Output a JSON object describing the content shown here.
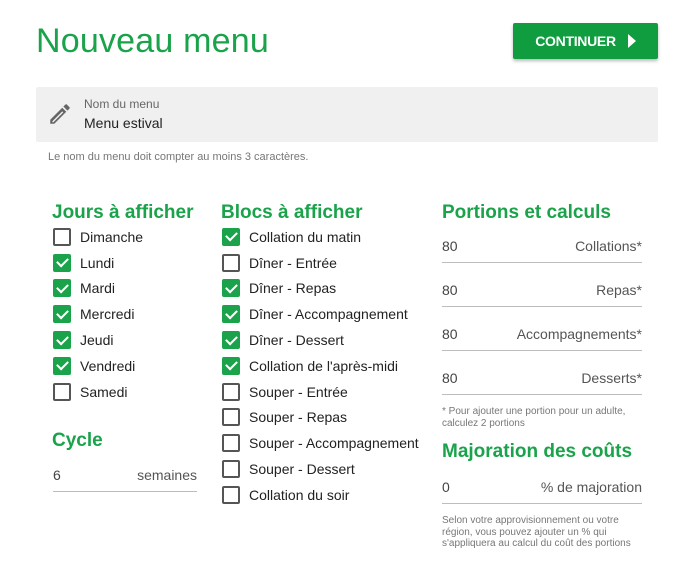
{
  "header": {
    "title": "Nouveau menu",
    "continue_label": "CONTINUER"
  },
  "name_field": {
    "label": "Nom du menu",
    "value": "Menu estival",
    "hint": "Le nom du menu doit compter au moins 3 caractères."
  },
  "days": {
    "heading": "Jours à afficher",
    "items": [
      {
        "label": "Dimanche",
        "checked": false
      },
      {
        "label": "Lundi",
        "checked": true
      },
      {
        "label": "Mardi",
        "checked": true
      },
      {
        "label": "Mercredi",
        "checked": true
      },
      {
        "label": "Jeudi",
        "checked": true
      },
      {
        "label": "Vendredi",
        "checked": true
      },
      {
        "label": "Samedi",
        "checked": false
      }
    ]
  },
  "cycle": {
    "heading": "Cycle",
    "value": "6",
    "unit": "semaines"
  },
  "blocks": {
    "heading": "Blocs à afficher",
    "items": [
      {
        "label": "Collation du matin",
        "checked": true
      },
      {
        "label": "Dîner - Entrée",
        "checked": false
      },
      {
        "label": "Dîner - Repas",
        "checked": true
      },
      {
        "label": "Dîner - Accompagnement",
        "checked": true
      },
      {
        "label": "Dîner - Dessert",
        "checked": true
      },
      {
        "label": "Collation de l'après-midi",
        "checked": true
      },
      {
        "label": "Souper - Entrée",
        "checked": false
      },
      {
        "label": "Souper - Repas",
        "checked": false
      },
      {
        "label": "Souper - Accompagnement",
        "checked": false
      },
      {
        "label": "Souper - Dessert",
        "checked": false
      },
      {
        "label": "Collation du soir",
        "checked": false
      }
    ]
  },
  "portions": {
    "heading": "Portions et calculs",
    "rows": [
      {
        "value": "80",
        "label": "Collations*"
      },
      {
        "value": "80",
        "label": "Repas*"
      },
      {
        "value": "80",
        "label": "Accompagnements*"
      },
      {
        "value": "80",
        "label": "Desserts*"
      }
    ],
    "note": "* Pour ajouter une portion pour un adulte, calculez 2 portions"
  },
  "markup": {
    "heading": "Majoration des coûts",
    "value": "0",
    "label": "% de majoration",
    "note": "Selon votre approvisionnement ou votre région, vous pouvez ajouter un % qui s'appliquera au calcul du coût des portions"
  },
  "colors": {
    "accent": "#1aa34a",
    "button": "#0f9d3f"
  }
}
